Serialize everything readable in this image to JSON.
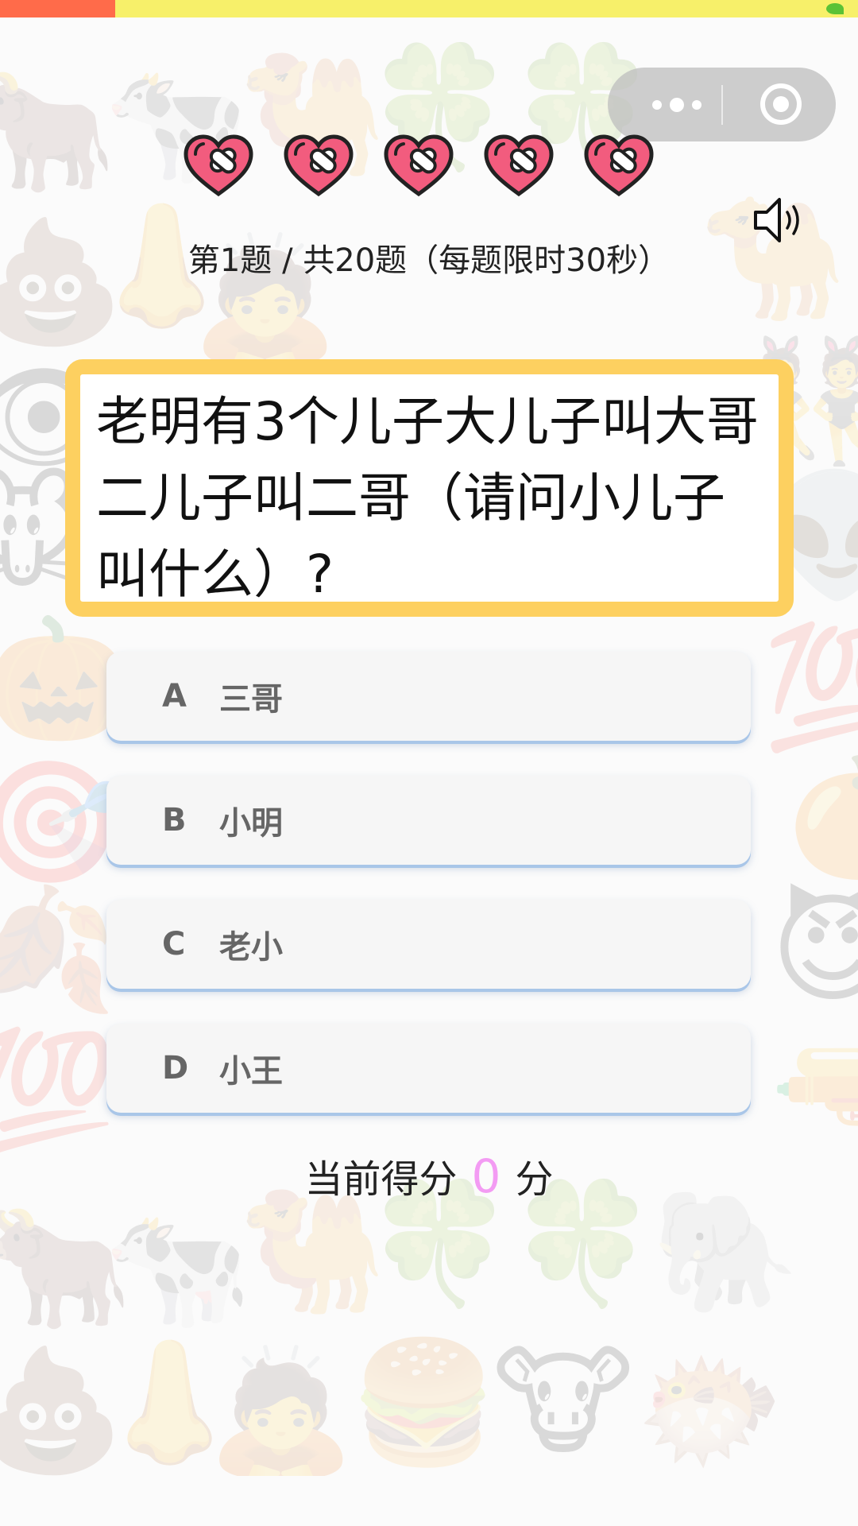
{
  "colors": {
    "heart": "#f25c7e",
    "question_border": "#fdd060",
    "score_value": "#f39bf3",
    "option_shadow": "#a9c6e8"
  },
  "header": {
    "lives": 5,
    "progress_text": "第1题 / 共20题（每题限时30秒）"
  },
  "question": {
    "text": "老明有3个儿子大儿子叫大哥二儿子叫二哥（请问小儿子叫什么）?"
  },
  "options": [
    {
      "letter": "A",
      "text": "三哥"
    },
    {
      "letter": "B",
      "text": "小明"
    },
    {
      "letter": "C",
      "text": "老小"
    },
    {
      "letter": "D",
      "text": "小王"
    }
  ],
  "score": {
    "prefix": "当前得分",
    "value": "0",
    "suffix": "分"
  }
}
